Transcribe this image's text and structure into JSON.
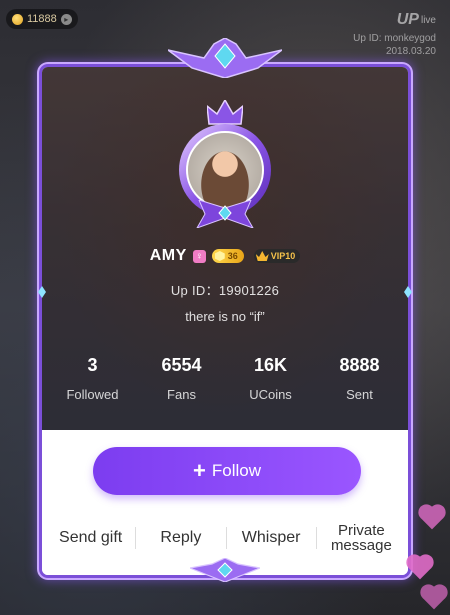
{
  "colors": {
    "accent": "#8a4cf6",
    "frame": "#7b4fd8",
    "level_badge": "#f0b428",
    "vip": "#f5c24a",
    "gender": "#f07cc4"
  },
  "stream": {
    "coin_balance": "11888",
    "live_logo": "UP",
    "live_text": "live",
    "watermark_id": "Up ID: monkeygod",
    "watermark_date": "2018.03.20"
  },
  "profile": {
    "name": "AMY",
    "gender_icon": "female-icon",
    "level": "36",
    "vip": "VIP10",
    "up_id": "Up ID：19901226",
    "bio": "there is no “if”"
  },
  "stats": [
    {
      "value": "3",
      "label": "Followed"
    },
    {
      "value": "6554",
      "label": "Fans"
    },
    {
      "value": "16K",
      "label": "UCoins"
    },
    {
      "value": "8888",
      "label": "Sent"
    }
  ],
  "follow": {
    "label": "Follow",
    "icon": "plus-icon"
  },
  "actions": {
    "send_gift": "Send gift",
    "reply": "Reply",
    "whisper": "Whisper",
    "private_message": "Private message"
  }
}
